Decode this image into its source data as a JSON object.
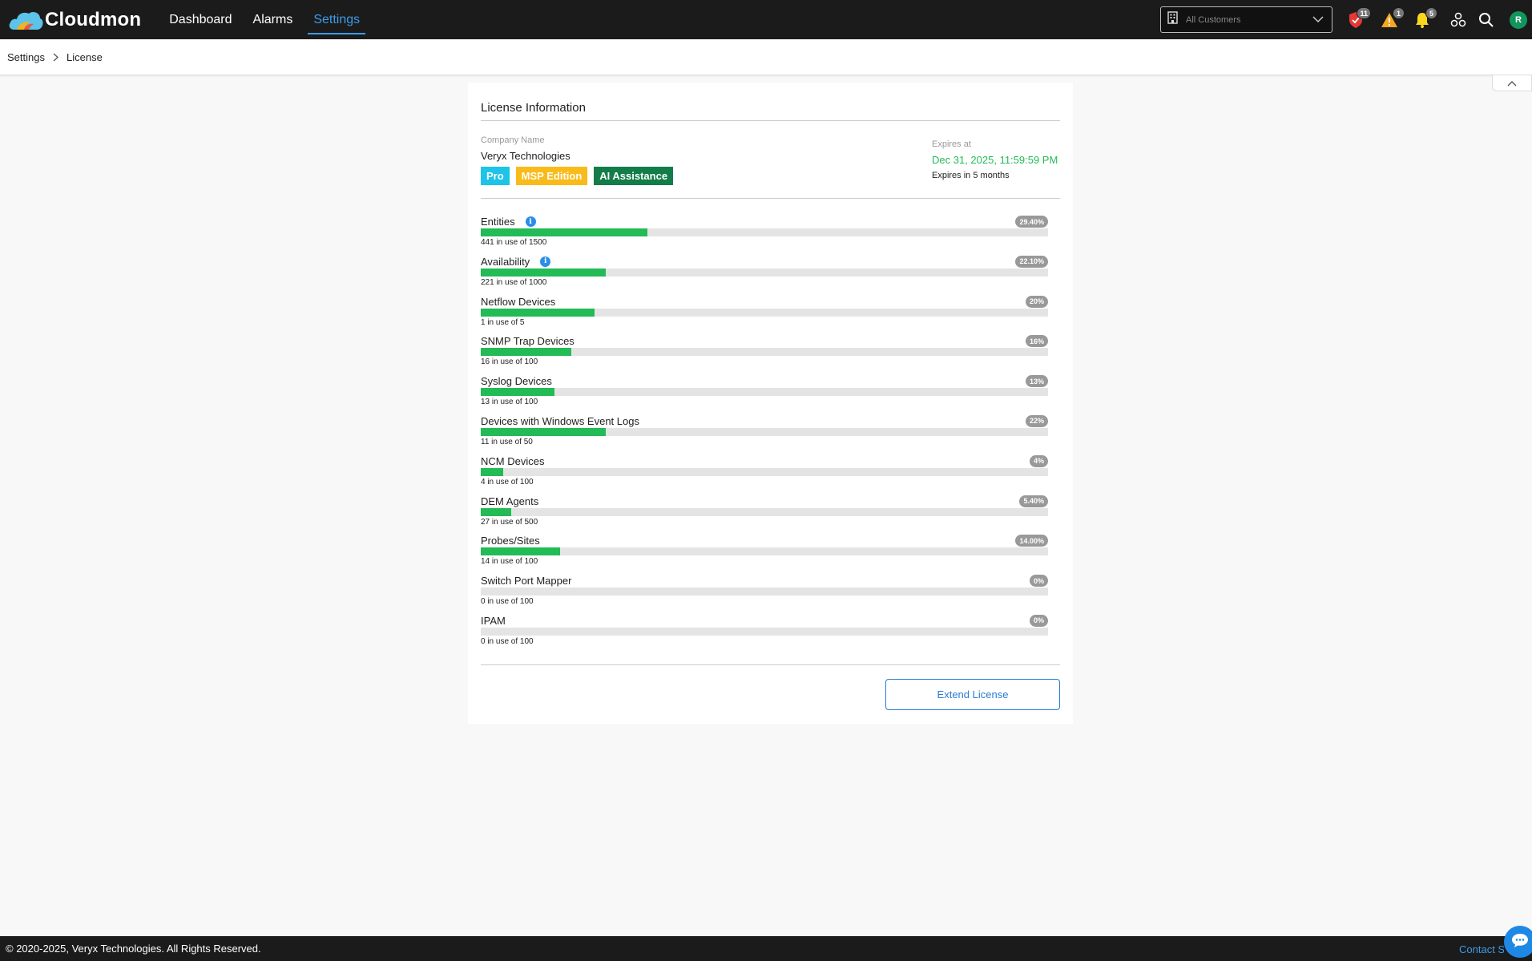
{
  "header": {
    "brand": "Cloudmon",
    "nav": [
      {
        "label": "Dashboard"
      },
      {
        "label": "Alarms"
      },
      {
        "label": "Settings"
      }
    ],
    "customer_select": {
      "placeholder": "All Customers"
    },
    "icons": [
      {
        "name": "security-shield-icon",
        "badge": "11",
        "color": "#e53935"
      },
      {
        "name": "warning-icon",
        "badge": "1",
        "color": "#f5a623"
      },
      {
        "name": "notification-bell-icon",
        "badge": "5",
        "color": "#f9d71c"
      },
      {
        "name": "integrations-icon"
      },
      {
        "name": "search-icon"
      }
    ],
    "avatar_initial": "R"
  },
  "breadcrumb": [
    {
      "label": "Settings"
    },
    {
      "label": "License"
    }
  ],
  "license": {
    "title": "License Information",
    "company_label": "Company Name",
    "company_name": "Veryx Technologies",
    "tags": [
      {
        "label": "Pro",
        "color": "#1ec3e8"
      },
      {
        "label": "MSP Edition",
        "color": "#f9bb1a"
      },
      {
        "label": "AI Assistance",
        "color": "#137d4a"
      }
    ],
    "expires_label": "Expires at",
    "expires_at": "Dec 31, 2025, 11:59:59 PM",
    "expires_relative": "Expires in 5 months",
    "meters": [
      {
        "label": "Entities",
        "info": true,
        "percent_text": "29.40%",
        "fill": 0.294,
        "usage": "441 in use of 1500"
      },
      {
        "label": "Availability",
        "info": true,
        "percent_text": "22.10%",
        "fill": 0.221,
        "usage": "221 in use of 1000"
      },
      {
        "label": "Netflow Devices",
        "info": false,
        "percent_text": "20%",
        "fill": 0.2,
        "usage": "1 in use of 5"
      },
      {
        "label": "SNMP Trap Devices",
        "info": false,
        "percent_text": "16%",
        "fill": 0.16,
        "usage": "16 in use of 100"
      },
      {
        "label": "Syslog Devices",
        "info": false,
        "percent_text": "13%",
        "fill": 0.13,
        "usage": "13 in use of 100"
      },
      {
        "label": "Devices with Windows Event Logs",
        "info": false,
        "percent_text": "22%",
        "fill": 0.22,
        "usage": "11 in use of 50"
      },
      {
        "label": "NCM Devices",
        "info": false,
        "percent_text": "4%",
        "fill": 0.04,
        "usage": "4 in use of 100"
      },
      {
        "label": "DEM Agents",
        "info": false,
        "percent_text": "5.40%",
        "fill": 0.054,
        "usage": "27 in use of 500"
      },
      {
        "label": "Probes/Sites",
        "info": false,
        "percent_text": "14.00%",
        "fill": 0.14,
        "usage": "14 in use of 100"
      },
      {
        "label": "Switch Port Mapper",
        "info": false,
        "percent_text": "0%",
        "fill": 0,
        "usage": "0 in use of 100"
      },
      {
        "label": "IPAM",
        "info": false,
        "percent_text": "0%",
        "fill": 0,
        "usage": "0 in use of 100"
      }
    ],
    "extend_button": "Extend License"
  },
  "footer": {
    "copyright": "© 2020-2025, Veryx Technologies. All Rights Reserved.",
    "contact": "Contact Support"
  },
  "colors": {
    "accent": "#3d9be9",
    "progress": "#22bb55",
    "expiry": "#22bb55"
  }
}
